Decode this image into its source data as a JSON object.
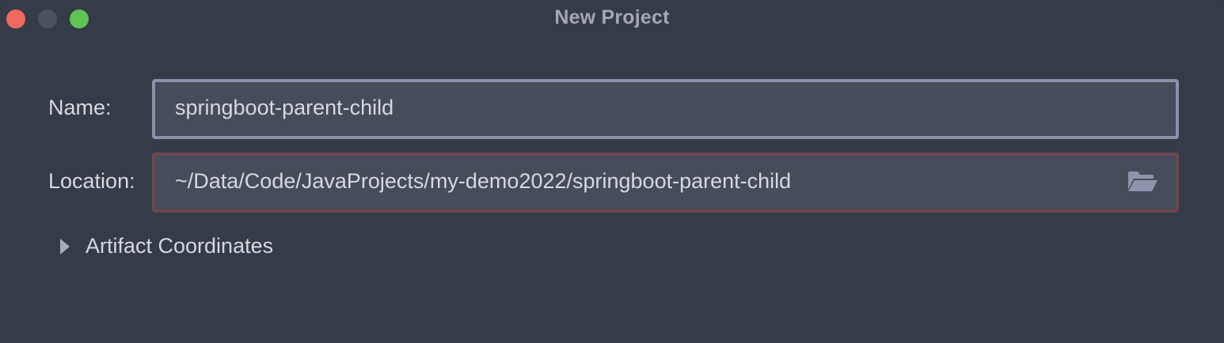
{
  "window": {
    "title": "New Project"
  },
  "form": {
    "name_label": "Name:",
    "name_value": "springboot-parent-child",
    "location_label": "Location:",
    "location_value": "~/Data/Code/JavaProjects/my-demo2022/springboot-parent-child",
    "location_icon": "folder-icon"
  },
  "artifact": {
    "label": "Artifact Coordinates",
    "icon": "chevron-right-icon",
    "expanded": false
  },
  "colors": {
    "background": "#353b47",
    "field_bg": "#464c5a",
    "name_border": "#8a91ab",
    "location_border_error": "#6a484d",
    "close": "#ee6a5e",
    "minimize": "#4e525c",
    "maximize": "#5fc454"
  }
}
